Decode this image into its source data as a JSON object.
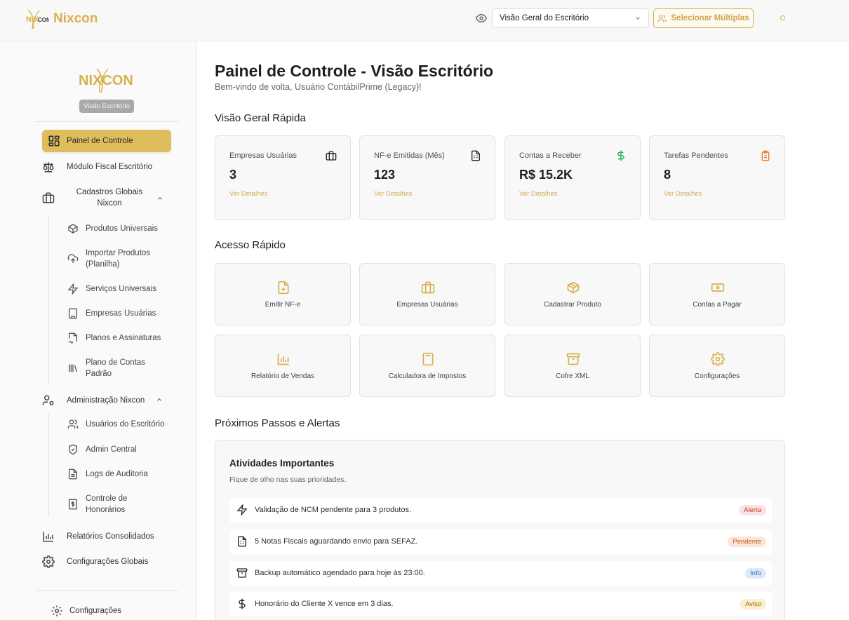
{
  "topbar": {
    "brand_name": "Nixcon",
    "view_select": "Visão Geral do Escritório",
    "multi_button": "Selecionar Múltiplas"
  },
  "sidebar": {
    "logo_text": "NIXCON",
    "badge": "Visão Escritório",
    "items": [
      {
        "label": "Painel de Controle",
        "icon": "dashboard-icon",
        "active": true
      },
      {
        "label": "Módulo Fiscal Escritório",
        "icon": "scale-icon"
      },
      {
        "label": "Cadastros Globais Nixcon",
        "icon": "briefcase-icon",
        "expanded": true
      },
      {
        "label": "Administração Nixcon",
        "icon": "user-cog-icon",
        "expanded": true
      },
      {
        "label": "Relatórios Consolidados",
        "icon": "bar-chart-icon"
      },
      {
        "label": "Configurações Globais",
        "icon": "gear-icon"
      }
    ],
    "cadastros_sub": [
      {
        "label": "Produtos Universais",
        "icon": "package-icon"
      },
      {
        "label": "Importar Produtos (Planilha)",
        "icon": "upload-cloud-icon"
      },
      {
        "label": "Serviços Universais",
        "icon": "zap-icon"
      },
      {
        "label": "Empresas Usuárias",
        "icon": "building-icon"
      },
      {
        "label": "Planos e Assinaturas",
        "icon": "file-signature-icon"
      },
      {
        "label": "Plano de Contas Padrão",
        "icon": "library-icon"
      }
    ],
    "admin_sub": [
      {
        "label": "Usuários do Escritório",
        "icon": "users-icon"
      },
      {
        "label": "Admin Central",
        "icon": "shield-icon"
      },
      {
        "label": "Logs de Auditoria",
        "icon": "file-text-icon"
      },
      {
        "label": "Controle de Honorários",
        "icon": "receipt-dollar-icon"
      }
    ],
    "footer": "Configurações"
  },
  "main": {
    "title": "Painel de Controle - Visão Escritório",
    "subtitle": "Bem-vindo de volta, Usuário ContábilPrime (Legacy)!",
    "overview_title": "Visão Geral Rápida",
    "cards": [
      {
        "label": "Empresas Usuárias",
        "value": "3",
        "link": "Ver Detalhes",
        "icon": "briefcase-icon",
        "color": "#222222"
      },
      {
        "label": "NF-e Emitidas (Mês)",
        "value": "123",
        "link": "Ver Detalhes",
        "icon": "spreadsheet-icon",
        "color": "#222222"
      },
      {
        "label": "Contas a Receber",
        "value": "R$ 15.2K",
        "link": "Ver Detalhes",
        "icon": "dollar-icon",
        "color": "#22b35e"
      },
      {
        "label": "Tarefas Pendentes",
        "value": "8",
        "link": "Ver Detalhes",
        "icon": "clipboard-icon",
        "color": "#f07a2a"
      }
    ],
    "quick_title": "Acesso Rápido",
    "quick": [
      {
        "label": "Emitir NF-e",
        "icon": "file-plus-icon"
      },
      {
        "label": "Empresas Usuárias",
        "icon": "briefcase-icon"
      },
      {
        "label": "Cadastrar Produto",
        "icon": "package-icon"
      },
      {
        "label": "Contas a Pagar",
        "icon": "banknote-icon"
      },
      {
        "label": "Relatório de Vendas",
        "icon": "bar-chart-icon"
      },
      {
        "label": "Calculadora de Impostos",
        "icon": "calculator-icon"
      },
      {
        "label": "Cofre XML",
        "icon": "archive-icon"
      },
      {
        "label": "Configurações",
        "icon": "gear-icon"
      }
    ],
    "alerts_section": "Próximos Passos e Alertas",
    "alerts_box": {
      "title": "Atividades Importantes",
      "subtitle": "Fique de olho nas suas prioridades.",
      "rows": [
        {
          "text": "Validação de NCM pendente para 3 produtos.",
          "tag": "Alerta",
          "icon": "zap-icon",
          "tag_bg": "#fde2e2",
          "tag_fg": "#c0392b"
        },
        {
          "text": "5 Notas Fiscais aguardando envio para SEFAZ.",
          "tag": "Pendente",
          "icon": "spreadsheet-icon",
          "tag_bg": "#fde6d8",
          "tag_fg": "#c2571a"
        },
        {
          "text": "Backup automático agendado para hoje às 23:00.",
          "tag": "Info",
          "icon": "archive-icon",
          "tag_bg": "#dde9fb",
          "tag_fg": "#2e5cb8"
        },
        {
          "text": "Honorário do Cliente X vence em 3 dias.",
          "tag": "Aviso",
          "icon": "dollar-icon",
          "tag_bg": "#fbefcf",
          "tag_fg": "#9a6a12"
        }
      ]
    }
  }
}
